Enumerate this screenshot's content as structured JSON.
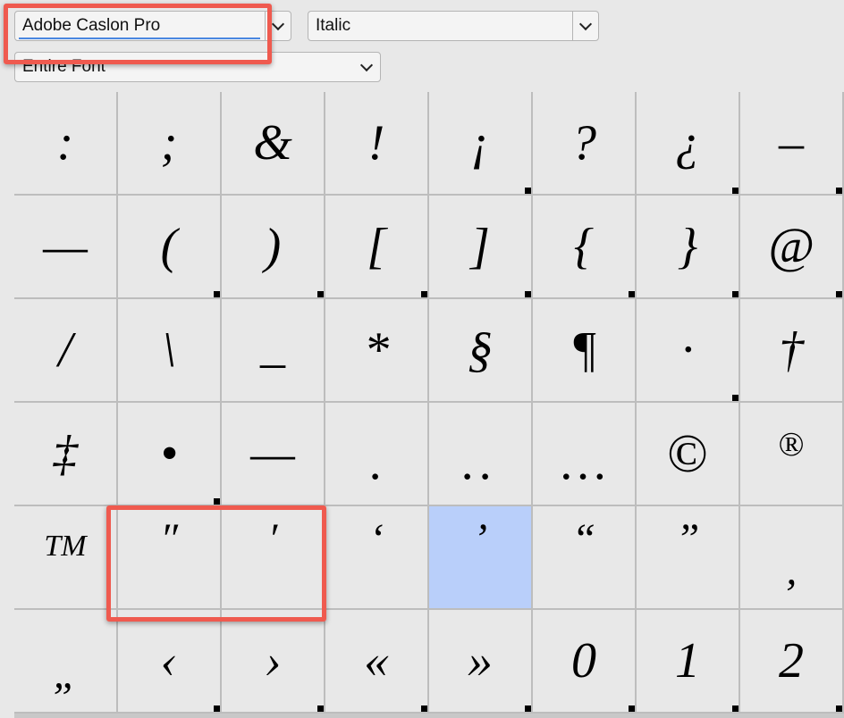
{
  "toolbar": {
    "font_family": "Adobe Caslon Pro",
    "font_style": "Italic",
    "glyph_range": "Entire Font"
  },
  "colors": {
    "highlight": "#ef5a4f",
    "selected_cell": "#b9cffa",
    "focus_underline": "#4a87e0"
  },
  "glyphs": [
    {
      "char": ":",
      "marker": false
    },
    {
      "char": ";",
      "marker": false
    },
    {
      "char": "&",
      "marker": false
    },
    {
      "char": "!",
      "marker": false
    },
    {
      "char": "¡",
      "marker": true
    },
    {
      "char": "?",
      "marker": false
    },
    {
      "char": "¿",
      "marker": true
    },
    {
      "char": "–",
      "marker": true
    },
    {
      "char": "—",
      "marker": false
    },
    {
      "char": "(",
      "marker": true
    },
    {
      "char": ")",
      "marker": true
    },
    {
      "char": "[",
      "marker": true
    },
    {
      "char": "]",
      "marker": true
    },
    {
      "char": "{",
      "marker": true
    },
    {
      "char": "}",
      "marker": true
    },
    {
      "char": "@",
      "marker": true
    },
    {
      "char": "/",
      "marker": false
    },
    {
      "char": "\\",
      "marker": false
    },
    {
      "char": "_",
      "marker": false
    },
    {
      "char": "*",
      "marker": false
    },
    {
      "char": "§",
      "marker": false
    },
    {
      "char": "¶",
      "marker": false
    },
    {
      "char": "·",
      "marker": true
    },
    {
      "char": "†",
      "marker": false
    },
    {
      "char": "‡",
      "marker": false
    },
    {
      "char": "•",
      "marker": true
    },
    {
      "char": "—",
      "marker": false
    },
    {
      "char": ".",
      "marker": false
    },
    {
      "char": "..",
      "marker": false
    },
    {
      "char": "…",
      "marker": false
    },
    {
      "char": "©",
      "marker": false
    },
    {
      "char": "®",
      "marker": false
    },
    {
      "char": "TM",
      "marker": false
    },
    {
      "char": "″",
      "marker": false
    },
    {
      "char": "′",
      "marker": false
    },
    {
      "char": "‘",
      "marker": false
    },
    {
      "char": "’",
      "marker": false,
      "selected": true
    },
    {
      "char": "“",
      "marker": false
    },
    {
      "char": "”",
      "marker": false
    },
    {
      "char": "‚",
      "marker": false
    },
    {
      "char": "„",
      "marker": false
    },
    {
      "char": "‹",
      "marker": true
    },
    {
      "char": "›",
      "marker": true
    },
    {
      "char": "«",
      "marker": true
    },
    {
      "char": "»",
      "marker": true
    },
    {
      "char": "0",
      "marker": true
    },
    {
      "char": "1",
      "marker": true
    },
    {
      "char": "2",
      "marker": true
    }
  ]
}
